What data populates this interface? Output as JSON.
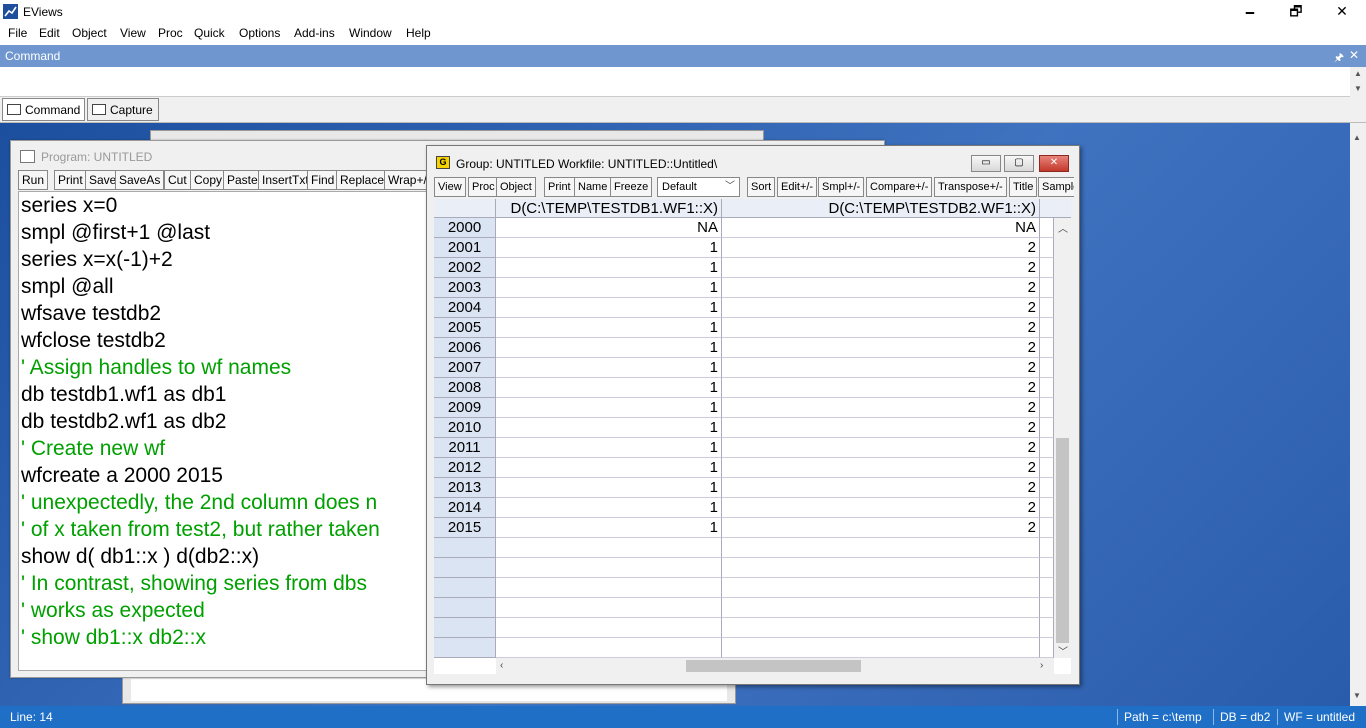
{
  "app": {
    "title": "EViews",
    "minimize": "🗕",
    "restore": "🗗",
    "close": "✕"
  },
  "menu": [
    "File",
    "Edit",
    "Object",
    "View",
    "Proc",
    "Quick",
    "Options",
    "Add-ins",
    "Window",
    "Help"
  ],
  "command": {
    "header": "Command",
    "pin": "🖈",
    "close": "✕",
    "value": ""
  },
  "tabs": [
    "Command",
    "Capture"
  ],
  "program": {
    "title": "Program: UNTITLED",
    "toolbar": [
      "Run",
      "Print",
      "Save",
      "SaveAs",
      "Cut",
      "Copy",
      "Paste",
      "InsertTxt",
      "Find",
      "Replace",
      "Wrap+/-"
    ],
    "lines": [
      {
        "text": "series x=0",
        "comment": false
      },
      {
        "text": "smpl @first+1 @last",
        "comment": false
      },
      {
        "text": "series x=x(-1)+2",
        "comment": false
      },
      {
        "text": "smpl @all",
        "comment": false
      },
      {
        "text": "wfsave testdb2",
        "comment": false
      },
      {
        "text": "wfclose  testdb2",
        "comment": false
      },
      {
        "text": "' Assign handles to wf names",
        "comment": true
      },
      {
        "text": "db testdb1.wf1 as db1",
        "comment": false
      },
      {
        "text": "db testdb2.wf1 as db2",
        "comment": false
      },
      {
        "text": "' Create new wf",
        "comment": true
      },
      {
        "text": "wfcreate a 2000 2015",
        "comment": false
      },
      {
        "text": "' unexpectedly, the 2nd column does n",
        "comment": true
      },
      {
        "text": "' of x taken from test2, but rather taken",
        "comment": true
      },
      {
        "text": "show d( db1::x ) d(db2::x)",
        "comment": false
      },
      {
        "text": "' In contrast, showing series from dbs",
        "comment": true
      },
      {
        "text": "'  works as expected",
        "comment": true
      },
      {
        "text": "'  show db1::x db2::x",
        "comment": true
      }
    ]
  },
  "group": {
    "title": "Group: UNTITLED   Workfile: UNTITLED::Untitled\\",
    "icon_letter": "G",
    "toolbar_left": [
      "View",
      "Proc",
      "Object",
      "Print",
      "Name",
      "Freeze"
    ],
    "display_select": "Default",
    "toolbar_right": [
      "Sort",
      "Edit+/-",
      "Smpl+/-",
      "Compare+/-",
      "Transpose+/-",
      "Title",
      "Sample"
    ],
    "col1_header": "D(C:\\TEMP\\TESTDB1.WF1::X)",
    "col2_header": "D(C:\\TEMP\\TESTDB2.WF1::X)",
    "rows": [
      {
        "year": "2000",
        "c1": "NA",
        "c2": "NA"
      },
      {
        "year": "2001",
        "c1": "1",
        "c2": "2"
      },
      {
        "year": "2002",
        "c1": "1",
        "c2": "2"
      },
      {
        "year": "2003",
        "c1": "1",
        "c2": "2"
      },
      {
        "year": "2004",
        "c1": "1",
        "c2": "2"
      },
      {
        "year": "2005",
        "c1": "1",
        "c2": "2"
      },
      {
        "year": "2006",
        "c1": "1",
        "c2": "2"
      },
      {
        "year": "2007",
        "c1": "1",
        "c2": "2"
      },
      {
        "year": "2008",
        "c1": "1",
        "c2": "2"
      },
      {
        "year": "2009",
        "c1": "1",
        "c2": "2"
      },
      {
        "year": "2010",
        "c1": "1",
        "c2": "2"
      },
      {
        "year": "2011",
        "c1": "1",
        "c2": "2"
      },
      {
        "year": "2012",
        "c1": "1",
        "c2": "2"
      },
      {
        "year": "2013",
        "c1": "1",
        "c2": "2"
      },
      {
        "year": "2014",
        "c1": "1",
        "c2": "2"
      },
      {
        "year": "2015",
        "c1": "1",
        "c2": "2"
      }
    ]
  },
  "status": {
    "line": "Line: 14",
    "path": "Path = c:\\temp",
    "db": "DB = db2",
    "wf": "WF = untitled"
  }
}
